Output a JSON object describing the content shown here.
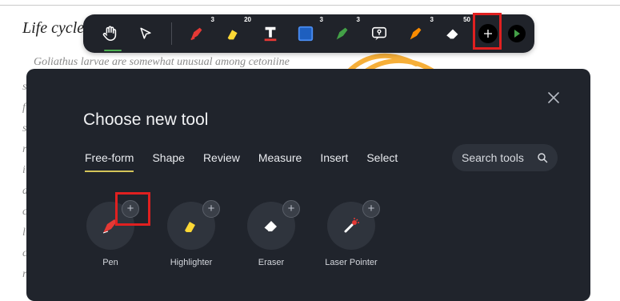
{
  "document": {
    "title": "Life cycle",
    "paragraph_start": "Goliathus larvae are somewhat unusual among cetoniine",
    "line_starts": [
      "s",
      "f",
      "s",
      "r",
      "i",
      "d",
      "c",
      "l",
      "c",
      "r",
      "c"
    ]
  },
  "toolbar": {
    "tools": [
      {
        "icon": "hand-icon"
      },
      {
        "icon": "pointer-icon"
      },
      {
        "icon": "red-pen-icon",
        "count": "3",
        "color": "#e53935"
      },
      {
        "icon": "yellow-highlighter-icon",
        "count": "20",
        "color": "#fdd835"
      },
      {
        "icon": "text-tool-icon",
        "color": "#e53935"
      },
      {
        "icon": "blue-shape-icon",
        "count": "3",
        "color": "#1e88e5"
      },
      {
        "icon": "green-pen-icon",
        "count": "3",
        "color": "#43a047"
      },
      {
        "icon": "comment-icon"
      },
      {
        "icon": "orange-pen-icon",
        "count": "3",
        "color": "#fb8c00"
      },
      {
        "icon": "eraser-icon",
        "count": "50"
      },
      {
        "icon": "add-tool-icon"
      },
      {
        "icon": "green-arrow-icon",
        "color": "#43a047"
      }
    ]
  },
  "dialog": {
    "title": "Choose new tool",
    "tabs": [
      "Free-form",
      "Shape",
      "Review",
      "Measure",
      "Insert",
      "Select"
    ],
    "active_tab": "Free-form",
    "search_placeholder": "Search tools",
    "tools": [
      {
        "label": "Pen"
      },
      {
        "label": "Highlighter"
      },
      {
        "label": "Eraser"
      },
      {
        "label": "Laser Pointer"
      }
    ]
  }
}
